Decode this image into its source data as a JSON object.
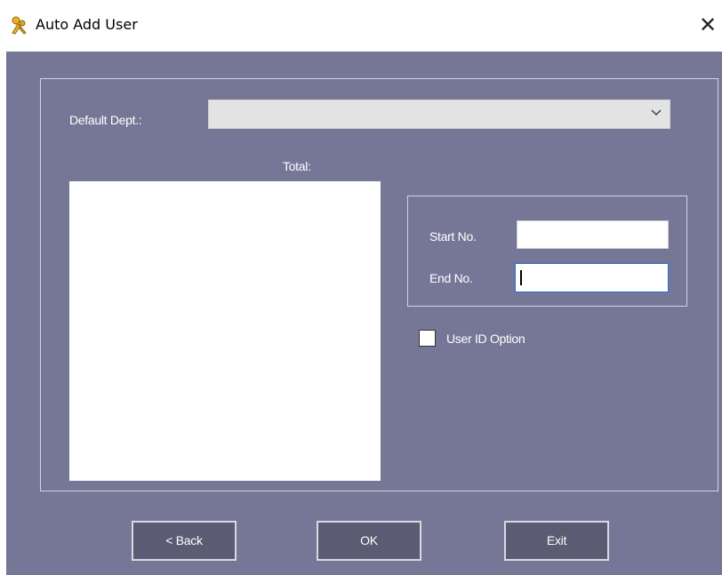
{
  "window": {
    "title": "Auto Add User",
    "icon": "user-key-icon",
    "close_symbol": "✕"
  },
  "form": {
    "default_dept_label": "Default Dept.:",
    "default_dept_value": "",
    "total_label": "Total:",
    "start_no_label": "Start No.",
    "start_no_value": "",
    "end_no_label": "End No.",
    "end_no_value": "",
    "user_id_option_label": "User ID Option",
    "user_id_option_checked": false
  },
  "buttons": {
    "back": "< Back",
    "ok": "OK",
    "exit": "Exit"
  },
  "colors": {
    "client_background": "#767797",
    "button_background": "#5b5b73"
  }
}
